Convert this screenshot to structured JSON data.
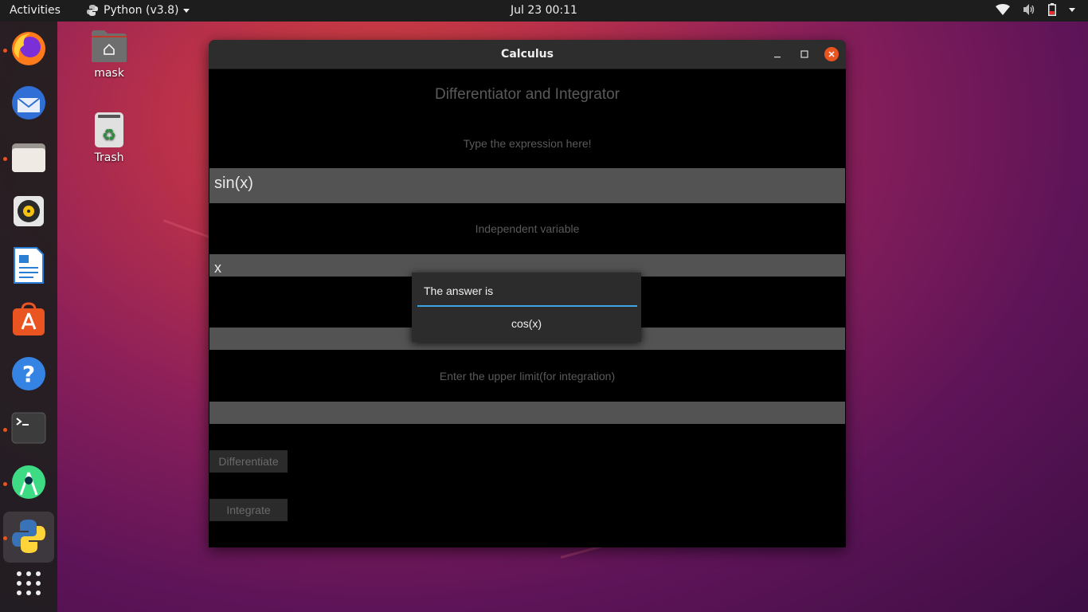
{
  "topbar": {
    "activities": "Activities",
    "app_menu": "Python (v3.8)",
    "clock": "Jul 23  00:11"
  },
  "desktop": {
    "home_label": "mask",
    "trash_label": "Trash"
  },
  "dock": {
    "items": [
      "firefox-icon",
      "thunderbird-icon",
      "files-icon",
      "rhythmbox-icon",
      "libreoffice-writer-icon",
      "software-center-icon",
      "help-icon",
      "terminal-icon",
      "android-studio-icon",
      "python-icon",
      "show-apps-icon"
    ]
  },
  "window": {
    "title": "Calculus",
    "heading": "Differentiator and Integrator",
    "expression_label": "Type the expression here!",
    "expression_value": "sin(x)",
    "variable_label": "Independent variable",
    "variable_value": "x",
    "upper_limit_label": "Enter the upper limit(for integration)",
    "differentiate_label": "Differentiate",
    "integrate_label": "Integrate"
  },
  "popup": {
    "title": "The answer is",
    "answer": "cos(x)"
  },
  "colors": {
    "accent": "#e95420",
    "popup_underline": "#3aa6e0"
  }
}
